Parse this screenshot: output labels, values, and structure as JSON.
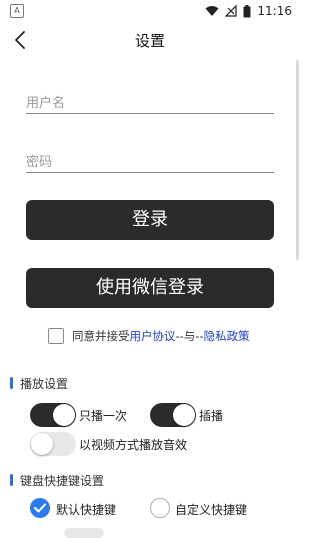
{
  "status_bar": {
    "time": "11:16",
    "left_icon": "A"
  },
  "header": {
    "title": "设置",
    "back_icon": "back-arrow-icon"
  },
  "login": {
    "username_placeholder": "用户名",
    "password_placeholder": "密码",
    "login_label": "登录",
    "wechat_login_label": "使用微信登录",
    "agreement": {
      "prefix": "同意并接受",
      "user_agreement": "用户协议",
      "separator": "--与--",
      "privacy_policy": "隐私政策",
      "checked": false
    }
  },
  "playback_settings": {
    "title": "播放设置",
    "options": [
      {
        "label": "只播一次",
        "enabled": true
      },
      {
        "label": "插播",
        "enabled": true
      },
      {
        "label": "以视频方式播放音效",
        "enabled": false
      }
    ]
  },
  "keyboard_shortcut_settings": {
    "title": "键盘快捷键设置",
    "options": [
      {
        "label": "默认快捷键",
        "selected": true
      },
      {
        "label": "自定义快捷键",
        "selected": false
      }
    ]
  },
  "colors": {
    "accent": "#2a7bf0",
    "button_dark": "#2b2b2b",
    "link": "#1a3fd0"
  }
}
